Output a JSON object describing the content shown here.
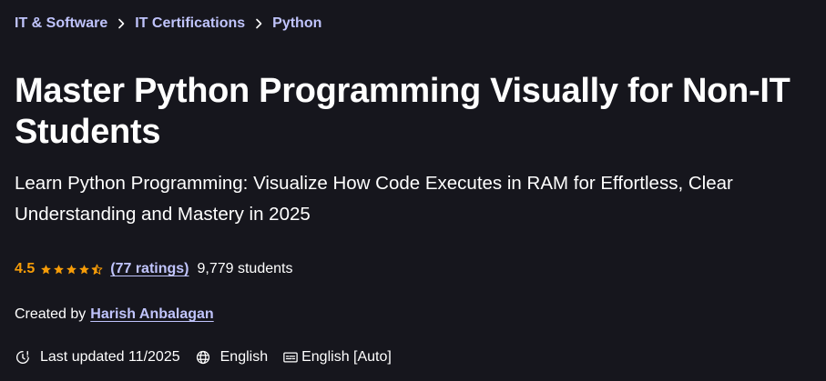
{
  "breadcrumb": {
    "items": [
      {
        "label": "IT & Software"
      },
      {
        "label": "IT Certifications"
      },
      {
        "label": "Python"
      }
    ]
  },
  "course": {
    "title": "Master Python Programming Visually for Non-IT Students",
    "subtitle": "Learn Python Programming: Visualize How Code Executes in RAM for Effortless, Clear Understanding and Mastery in 2025",
    "rating": "4.5",
    "rating_value": 4.5,
    "ratings_count_label": "(77 ratings)",
    "students_label": "9,779 students",
    "created_by_label": "Created by",
    "author": "Harish Anbalagan",
    "last_updated_label": "Last updated 11/2025",
    "language": "English",
    "captions": "English [Auto]"
  },
  "colors": {
    "background": "#16161d",
    "link": "#c0c4fc",
    "rating": "#f69c08",
    "text": "#ffffff"
  },
  "icons": {
    "breadcrumb_separator": "chevron-right-icon",
    "star": "star-icon",
    "updated": "alert-clock-icon",
    "language": "globe-icon",
    "captions": "closed-captions-icon"
  }
}
